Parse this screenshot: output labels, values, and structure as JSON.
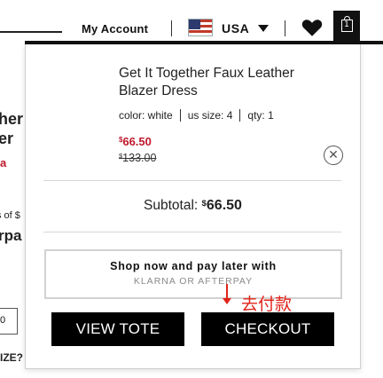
{
  "header": {
    "my_account": "My Account",
    "country": "USA",
    "tote_count": "1",
    "icons": [
      "us-flag-icon",
      "caret-down-icon",
      "heart-icon",
      "tote-bag-icon"
    ]
  },
  "background_page": {
    "fragment_1": "her",
    "fragment_2": "er",
    "fragment_3": "a",
    "fragment_4": "s of $",
    "fragment_5": "rpa",
    "qty_fragment": "0",
    "fragment_6": "IZE?"
  },
  "cart": {
    "item": {
      "title": "Get It Together Faux Leather Blazer Dress",
      "color": "color: white",
      "size": "us size: 4",
      "qty": "qty: 1",
      "sale_currency": "$",
      "sale_price": "66.50",
      "orig_currency": "$",
      "orig_price": "133.00"
    },
    "subtotal_label": "Subtotal:",
    "subtotal_currency": "$",
    "subtotal_amount": "66.50",
    "afterpay_line1": "Shop now and pay later with",
    "afterpay_line2": "KLARNA OR AFTERPAY",
    "view_tote_label": "VIEW TOTE",
    "checkout_label": "CHECKOUT",
    "annotation": "去付款"
  },
  "colors": {
    "sale_red": "#c0182b",
    "annotation_red": "#e2231a",
    "button_black": "#000000"
  }
}
